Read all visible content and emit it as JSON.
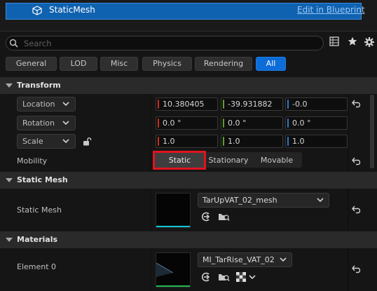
{
  "component": {
    "name": "StaticMesh",
    "edit_link": "Edit in Blueprint"
  },
  "search": {
    "placeholder": "Search"
  },
  "tabs": [
    {
      "label": "General",
      "active": false
    },
    {
      "label": "LOD",
      "active": false
    },
    {
      "label": "Misc",
      "active": false
    },
    {
      "label": "Physics",
      "active": false
    },
    {
      "label": "Rendering",
      "active": false
    },
    {
      "label": "All",
      "active": true
    }
  ],
  "transform": {
    "title": "Transform",
    "location": {
      "mode": "Location",
      "x": "10.380405",
      "y": "-39.931882",
      "z": "-0.0"
    },
    "rotation": {
      "mode": "Rotation",
      "x": "0.0 °",
      "y": "0.0 °",
      "z": "0.0 °"
    },
    "scale": {
      "mode": "Scale",
      "x": "1.0",
      "y": "1.0",
      "z": "1.0"
    },
    "mobility": {
      "label": "Mobility",
      "options": [
        "Static",
        "Stationary",
        "Movable"
      ],
      "selected": "Static"
    }
  },
  "static_mesh": {
    "title": "Static Mesh",
    "label": "Static Mesh",
    "asset": "TarUpVAT_02_mesh"
  },
  "materials": {
    "title": "Materials",
    "label": "Element 0",
    "asset": "MI_TarRise_VAT_02"
  },
  "colors": {
    "accent": "#0c6cd8",
    "x_axis": "#c8321e",
    "y_axis": "#5aa02c",
    "z_axis": "#2f77d6",
    "highlight": "#e0141e",
    "mesh_strip": "#12c4d4",
    "material_strip": "#1fb84c"
  }
}
